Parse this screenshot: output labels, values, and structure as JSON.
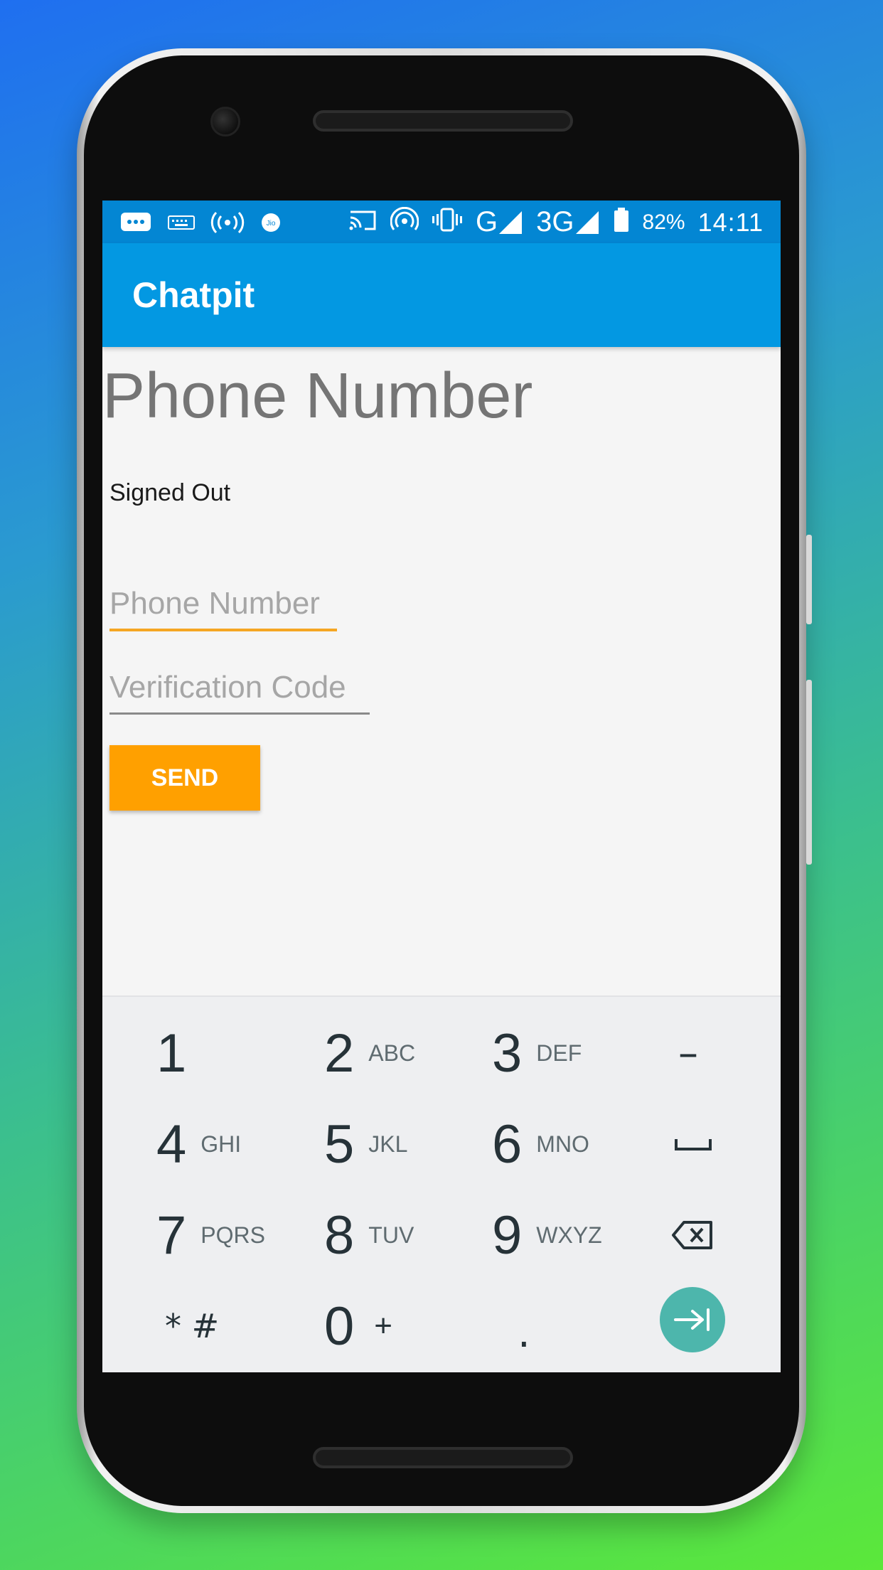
{
  "statusbar": {
    "left_icons": [
      "message-icon",
      "keyboard-icon",
      "hotspot-icon",
      "jio-icon"
    ],
    "right_icons": [
      "cast-icon",
      "wifi-signal-icon",
      "vibrate-icon"
    ],
    "network1": "G",
    "network2": "3G",
    "battery": "82%",
    "time": "14:11"
  },
  "appbar": {
    "title": "Chatpit"
  },
  "main": {
    "page_title": "Phone Number",
    "auth_status": "Signed Out",
    "phone_placeholder": "Phone Number",
    "code_placeholder": "Verification Code",
    "send_label": "SEND"
  },
  "keyboard": {
    "keys": [
      {
        "num": "1",
        "sub": ""
      },
      {
        "num": "2",
        "sub": "ABC"
      },
      {
        "num": "3",
        "sub": "DEF"
      },
      {
        "num": "4",
        "sub": "GHI"
      },
      {
        "num": "5",
        "sub": "JKL"
      },
      {
        "num": "6",
        "sub": "MNO"
      },
      {
        "num": "7",
        "sub": "PQRS"
      },
      {
        "num": "8",
        "sub": "TUV"
      },
      {
        "num": "9",
        "sub": "WXYZ"
      },
      {
        "num": "0",
        "sub": "+"
      }
    ],
    "star_hash": "* #",
    "dash": "–",
    "dot": "."
  },
  "colors": {
    "statusbar": "#0386d3",
    "appbar": "#0398e2",
    "accent": "#ffa000",
    "go_button": "#4db6ac"
  }
}
